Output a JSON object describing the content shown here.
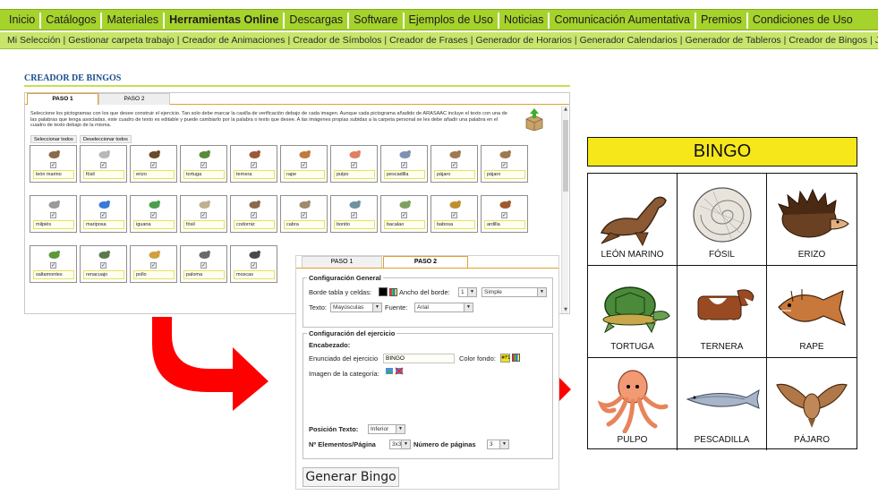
{
  "nav_main": [
    {
      "label": "Inicio",
      "bold": false
    },
    {
      "label": "Catálogos",
      "bold": false
    },
    {
      "label": "Materiales",
      "bold": false
    },
    {
      "label": "Herramientas Online",
      "bold": true
    },
    {
      "label": "Descargas",
      "bold": false
    },
    {
      "label": "Software",
      "bold": false
    },
    {
      "label": "Ejemplos de Uso",
      "bold": false
    },
    {
      "label": "Noticias",
      "bold": false
    },
    {
      "label": "Comunicación Aumentativa",
      "bold": false
    },
    {
      "label": "Premios",
      "bold": false
    },
    {
      "label": "Condiciones de Uso",
      "bold": false
    }
  ],
  "nav_sub": [
    {
      "label": "Mi Selección",
      "active": false
    },
    {
      "label": "Gestionar carpeta trabajo",
      "active": false
    },
    {
      "label": "Creador de Animaciones",
      "active": false
    },
    {
      "label": "Creador de Símbolos",
      "active": false
    },
    {
      "label": "Creador de Frases",
      "active": false
    },
    {
      "label": "Generador de Horarios",
      "active": false
    },
    {
      "label": "Generador Calendarios",
      "active": false
    },
    {
      "label": "Generador de Tableros",
      "active": false
    },
    {
      "label": "Creador de Bingos",
      "active": true
    },
    {
      "label": "Juego de la Oca",
      "active": false
    }
  ],
  "creator": {
    "title": "CREADOR DE BINGOS",
    "tab1": "PASO 1",
    "tab2": "PASO 2",
    "instructions": "Seleccione los pictogramas con los que desee construir el ejercicio. Tan solo debe marcar la casilla de verificación debajo de cada imagen. Aunque cada pictograma añadido de ARASAAC incluye el texto con una de las palabras que tenga asociadas, este cuadro de texto es editable y puede cambiarlo por la palabra o texto que desee. A las imágenes propias subidas a la carpeta personal se les debe añadir una palabra en el cuadro de texto debajo de la misma.",
    "select_all": "Seleccionar todos",
    "deselect_all": "Deseleccionar todos",
    "items": [
      "león marino",
      "fósil",
      "erizo",
      "tortuga",
      "ternera",
      "rape",
      "pulpo",
      "pescadilla",
      "pájaro",
      "pájaro",
      "milpiés",
      "mariposa",
      "iguana",
      "fósil",
      "codorniz",
      "cabra",
      "bonito",
      "bacalao",
      "babosa",
      "ardilla",
      "saltamontes",
      "renacuajo",
      "pollo",
      "paloma",
      "moscas"
    ],
    "check_mark": "✓"
  },
  "config": {
    "tab1": "PASO 1",
    "tab2": "PASO 2",
    "general_legend": "Configuración General",
    "border_label": "Borde tabla y celdas:",
    "border_width_label": "Ancho del borde:",
    "border_width_value": "1",
    "border_style_value": "Simple",
    "text_label": "Texto:",
    "text_value": "Mayúsculas",
    "font_label": "Fuente:",
    "font_value": "Arial",
    "exercise_legend": "Configuración del ejercicio",
    "header_label": "Encabezado:",
    "statement_label": "Enunciado del ejercicio",
    "statement_value": "BINGO",
    "bg_color_label": "Color fondo:",
    "bg_color_value": "#F1",
    "category_image_label": "Imagen de la categoría:",
    "text_position_label": "Posición Texto:",
    "text_position_value": "Inferior",
    "elements_label": "Nº Elementos/Página",
    "elements_value": "3x3",
    "pages_label": "Número de páginas",
    "pages_value": "3",
    "generate_button": "Generar Bingo",
    "colors": {
      "border": "#000000",
      "bg": "#F5E71A"
    }
  },
  "bingo": {
    "title": "BINGO",
    "cells": [
      "LEÓN MARINO",
      "FÓSIL",
      "ERIZO",
      "TORTUGA",
      "TERNERA",
      "RAPE",
      "PULPO",
      "PESCADILLA",
      "PÁJARO"
    ]
  },
  "colors": {
    "nav_main_bg": "#A6D22C",
    "nav_sub_bg": "#C8E56C",
    "active_underline": "#E02020",
    "arrow": "#FF0000",
    "bingo_header": "#F5E71A"
  }
}
